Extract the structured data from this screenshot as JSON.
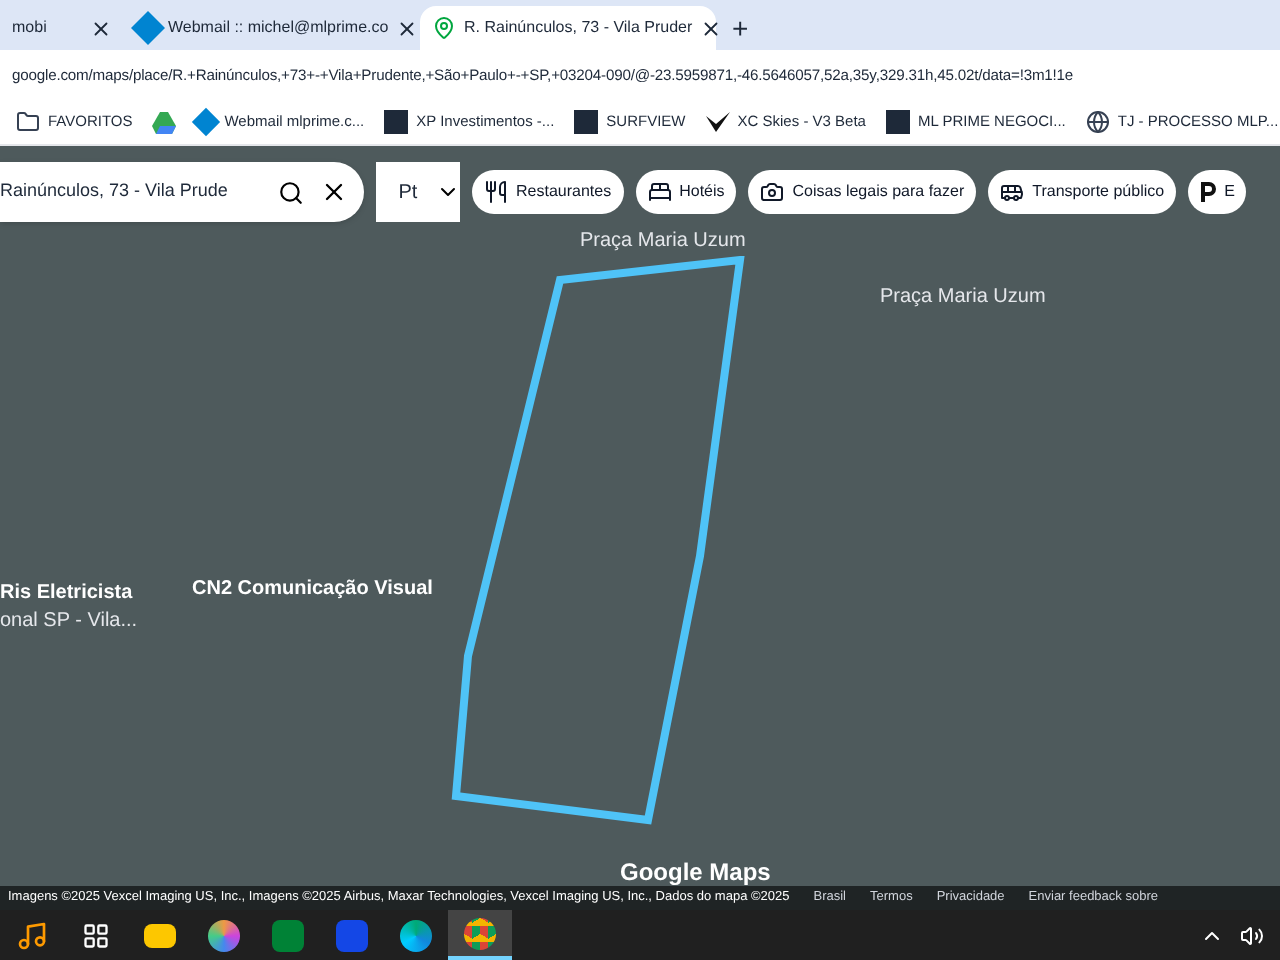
{
  "tabs": [
    {
      "title": "mobi",
      "selected": false,
      "kind": "plain"
    },
    {
      "title": "Webmail :: michel@mlprime.co",
      "selected": false,
      "kind": "mail"
    },
    {
      "title": "R. Rainúnculos, 73 - Vila Pruder",
      "selected": true,
      "kind": "pin"
    }
  ],
  "new_tab": "+",
  "address": "google.com/maps/place/R.+Rainúnculos,+73+-+Vila+Prudente,+São+Paulo+-+SP,+03204-090/@-23.5959871,-46.5646057,52a,35y,329.31h,45.02t/data=!3m1!1e",
  "bookmarks": [
    {
      "label": "FAVORITOS",
      "kind": "folder"
    },
    {
      "kind": "drive"
    },
    {
      "label": "Webmail mlprime.c...",
      "kind": "mail"
    },
    {
      "label": "XP Investimentos -...",
      "kind": "square"
    },
    {
      "label": "SURFVIEW",
      "kind": "square"
    },
    {
      "label": "XC Skies - V3 Beta",
      "kind": "bird"
    },
    {
      "label": "ML PRIME NEGOCI...",
      "kind": "square"
    },
    {
      "label": "TJ - PROCESSO MLP...",
      "kind": "globe"
    }
  ],
  "search": {
    "value": "Rainúnculos, 73 - Vila Prude"
  },
  "layer_button": "Pt",
  "chips": [
    {
      "label": "Restaurantes",
      "kind": "fork"
    },
    {
      "label": "Hotéis",
      "kind": "bed"
    },
    {
      "label": "Coisas legais para fazer",
      "kind": "camera"
    },
    {
      "label": "Transporte público",
      "kind": "bus"
    },
    {
      "label": "E",
      "kind": "parking"
    }
  ],
  "map_labels": [
    {
      "text": "Praça Maria Uzum",
      "kind": "street"
    },
    {
      "text": "Praça Maria Uzum",
      "kind": "street"
    },
    {
      "text": "Ris Eletricista",
      "kind": "place"
    },
    {
      "text": "onal SP - Vila...",
      "kind": "street"
    },
    {
      "text": "CN2 Comunicação Visual",
      "kind": "place"
    }
  ],
  "logo": "Google Maps",
  "attribution": "Imagens ©2025 Vexcel Imaging US, Inc., Imagens ©2025 Airbus, Maxar Technologies, Vexcel Imaging US, Inc., Dados do mapa ©2025",
  "footer_links": [
    "Brasil",
    "Termos",
    "Privacidade",
    "Enviar feedback sobre"
  ],
  "taskbar": [
    {
      "kind": "music",
      "selected": false
    },
    {
      "kind": "taskview",
      "selected": false
    },
    {
      "kind": "folder",
      "selected": false
    },
    {
      "kind": "photos",
      "selected": false
    },
    {
      "kind": "excel",
      "selected": false
    },
    {
      "kind": "word",
      "selected": false
    },
    {
      "kind": "edge",
      "selected": false
    },
    {
      "kind": "chrome",
      "selected": true
    }
  ]
}
